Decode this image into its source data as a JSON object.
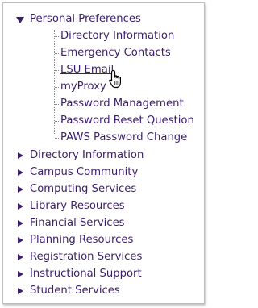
{
  "menu": {
    "expanded": {
      "label": "Personal Preferences",
      "children": [
        {
          "label": "Directory Information"
        },
        {
          "label": "Emergency Contacts"
        },
        {
          "label": "LSU Email"
        },
        {
          "label": "myProxy"
        },
        {
          "label": "Password Management"
        },
        {
          "label": "Password Reset Question"
        },
        {
          "label": "PAWS Password Change"
        }
      ],
      "hovered_child": "LSU Email"
    },
    "collapsed": [
      {
        "label": "Directory Information"
      },
      {
        "label": "Campus Community"
      },
      {
        "label": "Computing Services"
      },
      {
        "label": "Library Resources"
      },
      {
        "label": "Financial Services"
      },
      {
        "label": "Planning Resources"
      },
      {
        "label": "Registration Services"
      },
      {
        "label": "Instructional Support"
      },
      {
        "label": "Student Services"
      }
    ]
  },
  "colors": {
    "text": "#3b1f6b",
    "border": "#bdbdbd",
    "connector": "#8a8a8a"
  },
  "icons": {
    "expanded_toggle": "triangle-down-icon",
    "collapsed_toggle": "triangle-right-icon",
    "pointer": "hand-pointer-cursor-icon"
  }
}
